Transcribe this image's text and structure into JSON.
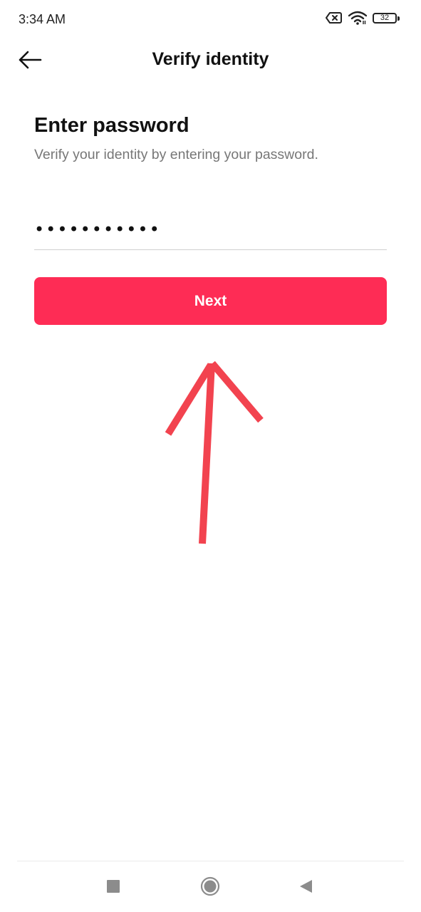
{
  "status_bar": {
    "time": "3:34 AM",
    "battery_level": "32",
    "icons": [
      "sim-off-icon",
      "wifi-icon",
      "battery-icon"
    ]
  },
  "header": {
    "title": "Verify identity",
    "back_icon": "arrow-left-icon"
  },
  "form": {
    "heading": "Enter password",
    "subheading": "Verify your identity by entering your password.",
    "password_value": "•••••••••••",
    "next_label": "Next"
  },
  "colors": {
    "primary": "#fe2c55",
    "annotation": "#f2434f"
  },
  "system_nav": {
    "icons": [
      "recents-square-icon",
      "home-circle-icon",
      "back-triangle-icon"
    ]
  }
}
